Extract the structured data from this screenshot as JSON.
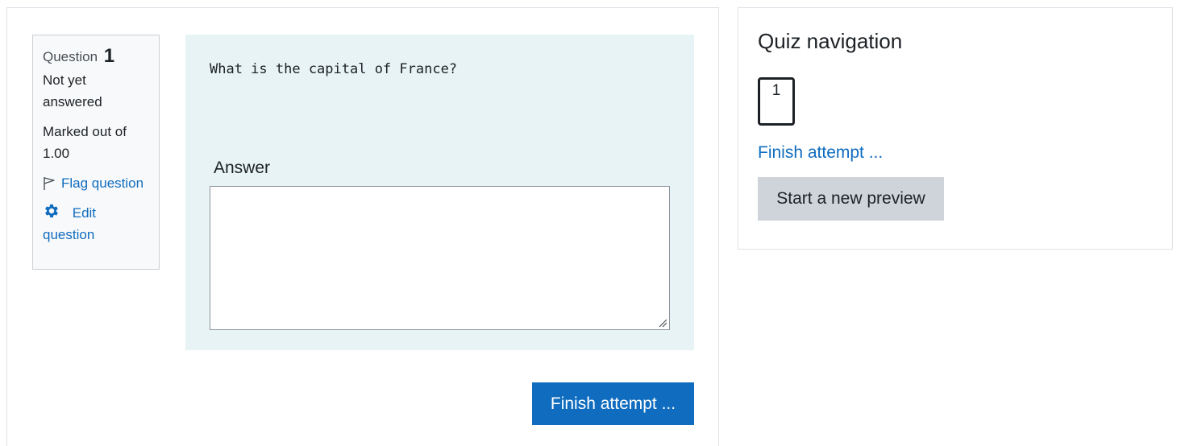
{
  "question_info": {
    "label": "Question",
    "number": "1",
    "state": "Not yet answered",
    "grade": "Marked out of 1.00",
    "flag_label": "Flag question",
    "edit_label": "Edit question"
  },
  "question": {
    "text": "What is the capital of France?",
    "answer_label": "Answer",
    "answer_value": "",
    "background_color": "#e7f3f5"
  },
  "actions": {
    "finish_label": "Finish attempt ...",
    "primary_color": "#0f6cbf"
  },
  "quiz_navigation": {
    "title": "Quiz navigation",
    "questions": [
      "1"
    ],
    "finish_link": "Finish attempt ...",
    "new_preview_label": "Start a new preview"
  },
  "icons": {
    "flag": "flag-icon",
    "edit": "gear-icon",
    "resize": "resize-grip-icon"
  }
}
